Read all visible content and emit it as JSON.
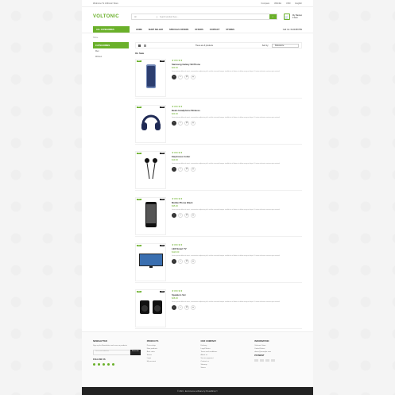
{
  "topbar": {
    "welcome": "Welcome To Voltronic Store",
    "links": [
      "Compare",
      "Wishlist",
      "USD",
      "English"
    ]
  },
  "header": {
    "logo_a": "VOLT",
    "logo_b": "ONIC",
    "search_cat": "All",
    "search_ph": "Search product here...",
    "cart_title": "My Basket",
    "cart_count": "0 item"
  },
  "nav": {
    "allcat": "ALL CATEGORIES",
    "items": [
      "HOME",
      "SHOP SELLER",
      "SPECIALS OFFERS",
      "OFFERS",
      "CONTACT",
      "STORES"
    ],
    "phone": "Call Us: 0123456789"
  },
  "crumb": "Home",
  "sidebar": {
    "title": "CATEGORIES",
    "items": [
      "Men",
      "Women"
    ]
  },
  "toolbar": {
    "showing": "There are 6 products",
    "sort_label": "Sort by:",
    "sort_value": "Relevance"
  },
  "section_title": "On Sale",
  "products": [
    {
      "name": "Samsung Galaxy S9 Phone",
      "price": "$23.00",
      "new": "New",
      "sale": "Sale",
      "img": "phone-blue"
    },
    {
      "name": "Beats Headphone Wireless",
      "price": "$23.00",
      "new": "New",
      "sale": "Sale",
      "img": "headphone"
    },
    {
      "name": "Earphones In-Ear",
      "price": "$19.00",
      "new": "New",
      "sale": "Sale",
      "img": "earphone"
    },
    {
      "name": "Mobile Phone Black",
      "price": "$35.00",
      "new": "New",
      "sale": "Sale",
      "img": "phone-black"
    },
    {
      "name": "LED Smart TV",
      "price": "$120.00",
      "new": "New",
      "sale": "Sale",
      "img": "tv"
    },
    {
      "name": "Speakers Set",
      "price": "$28.00",
      "new": "New",
      "sale": "Sale",
      "img": "speakers"
    }
  ],
  "desc": "Lorem ipsum dolor sit amet, consectetur adipiscing elit, sed do eiusmod tempor incididunt ut labore et dolore magna aliqua. Ut enim ad minim veniam quis nostrud.",
  "stars": "★★★★★",
  "showing_bottom": "Showing 1-6 of 6 item(s)",
  "footer": {
    "newsletter": {
      "title": "NEWSLETTER",
      "text": "Sign up for Newsletter and save on products",
      "placeholder": "Your email address",
      "button": "Subscribe",
      "follow": "FOLLOW US"
    },
    "products": {
      "title": "PRODUCTS",
      "links": [
        "Prices drop",
        "New products",
        "Best sales",
        "Stores",
        "Login",
        "My account"
      ]
    },
    "company": {
      "title": "OUR COMPANY",
      "links": [
        "Delivery",
        "Legal Notice",
        "Terms and conditions",
        "About us",
        "Secure payment",
        "Contact us",
        "Sitemap",
        "Stores"
      ]
    },
    "info": {
      "title": "INFORMATION",
      "lines": [
        "Voltronic Store",
        "United States",
        "demo@example.com"
      ],
      "payment": "PAYMENT"
    }
  },
  "copyright": "© 2024 - Ecommerce software by PrestaShop™"
}
